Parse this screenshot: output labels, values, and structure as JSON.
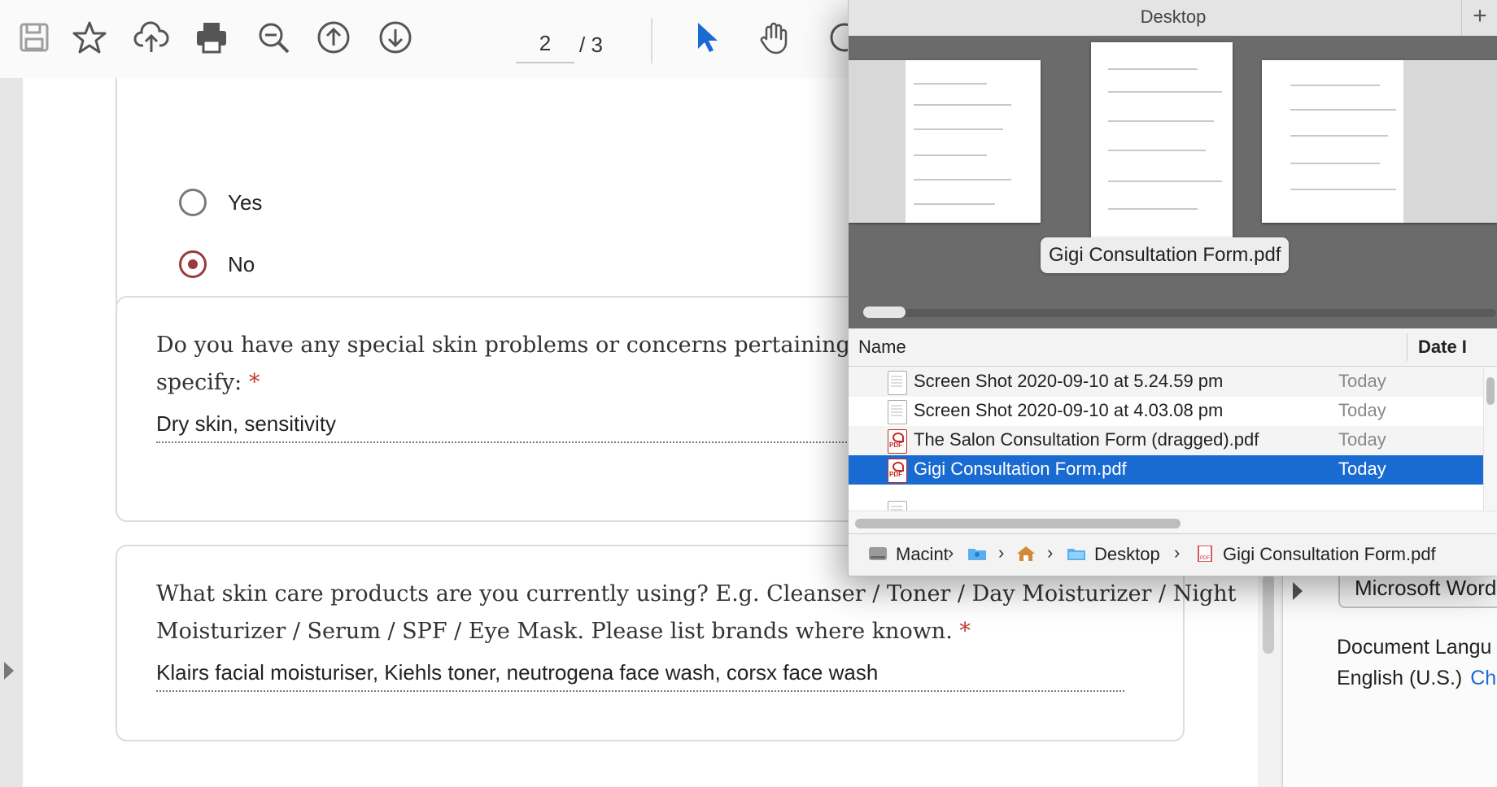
{
  "toolbar": {
    "page_current": "2",
    "page_total": "/ 3",
    "icons": [
      "save-icon",
      "star-icon",
      "upload-icon",
      "print-icon",
      "zoom-out-icon",
      "page-up-icon",
      "page-down-icon",
      "select-tool-icon",
      "hand-tool-icon"
    ]
  },
  "form": {
    "radio_yes_label": "Yes",
    "radio_no_label": "No",
    "selected": "No",
    "q1_text_line1": "Do you have any special skin problems or concerns pertaining to your f",
    "q1_text_line2": "specify:",
    "q1_required": "*",
    "q1_answer": "Dry skin, sensitivity",
    "q2_text_line1": "What skin care products are you currently using? E.g. Cleanser / Toner / Day Moisturizer / Night",
    "q2_text_line2": "Moisturizer / Serum / SPF / Eye Mask. Please list brands where known.",
    "q2_required": "*",
    "q2_answer": "Klairs facial moisturiser, Kiehls toner, neutrogena face wash, corsx face wash"
  },
  "right_panel": {
    "button_label": "Microsoft Word",
    "lang_label": "Document Langu",
    "lang_value": "English (U.S.)",
    "lang_change": "Ch"
  },
  "dialog": {
    "title": "Desktop",
    "plus": "+",
    "preview_label": "Gigi Consultation Form.pdf",
    "col_name": "Name",
    "col_date": "Date I",
    "files": [
      {
        "name": "Screen Shot 2020-09-10 at 5.24.59 pm",
        "date": "Today",
        "type": "image"
      },
      {
        "name": "Screen Shot 2020-09-10 at 4.03.08 pm",
        "date": "Today",
        "type": "image"
      },
      {
        "name": "The Salon Consultation Form (dragged).pdf",
        "date": "Today",
        "type": "pdf"
      },
      {
        "name": "Gigi Consultation Form.pdf",
        "date": "Today",
        "type": "pdf",
        "selected": true
      }
    ],
    "path": {
      "disk": "Macint",
      "folder": "Desktop",
      "file": "Gigi Consultation Form.pdf"
    }
  },
  "colors": {
    "selection": "#1a6bd1",
    "radio_selected": "#9a3a3a",
    "required_star": "#c0392b"
  }
}
